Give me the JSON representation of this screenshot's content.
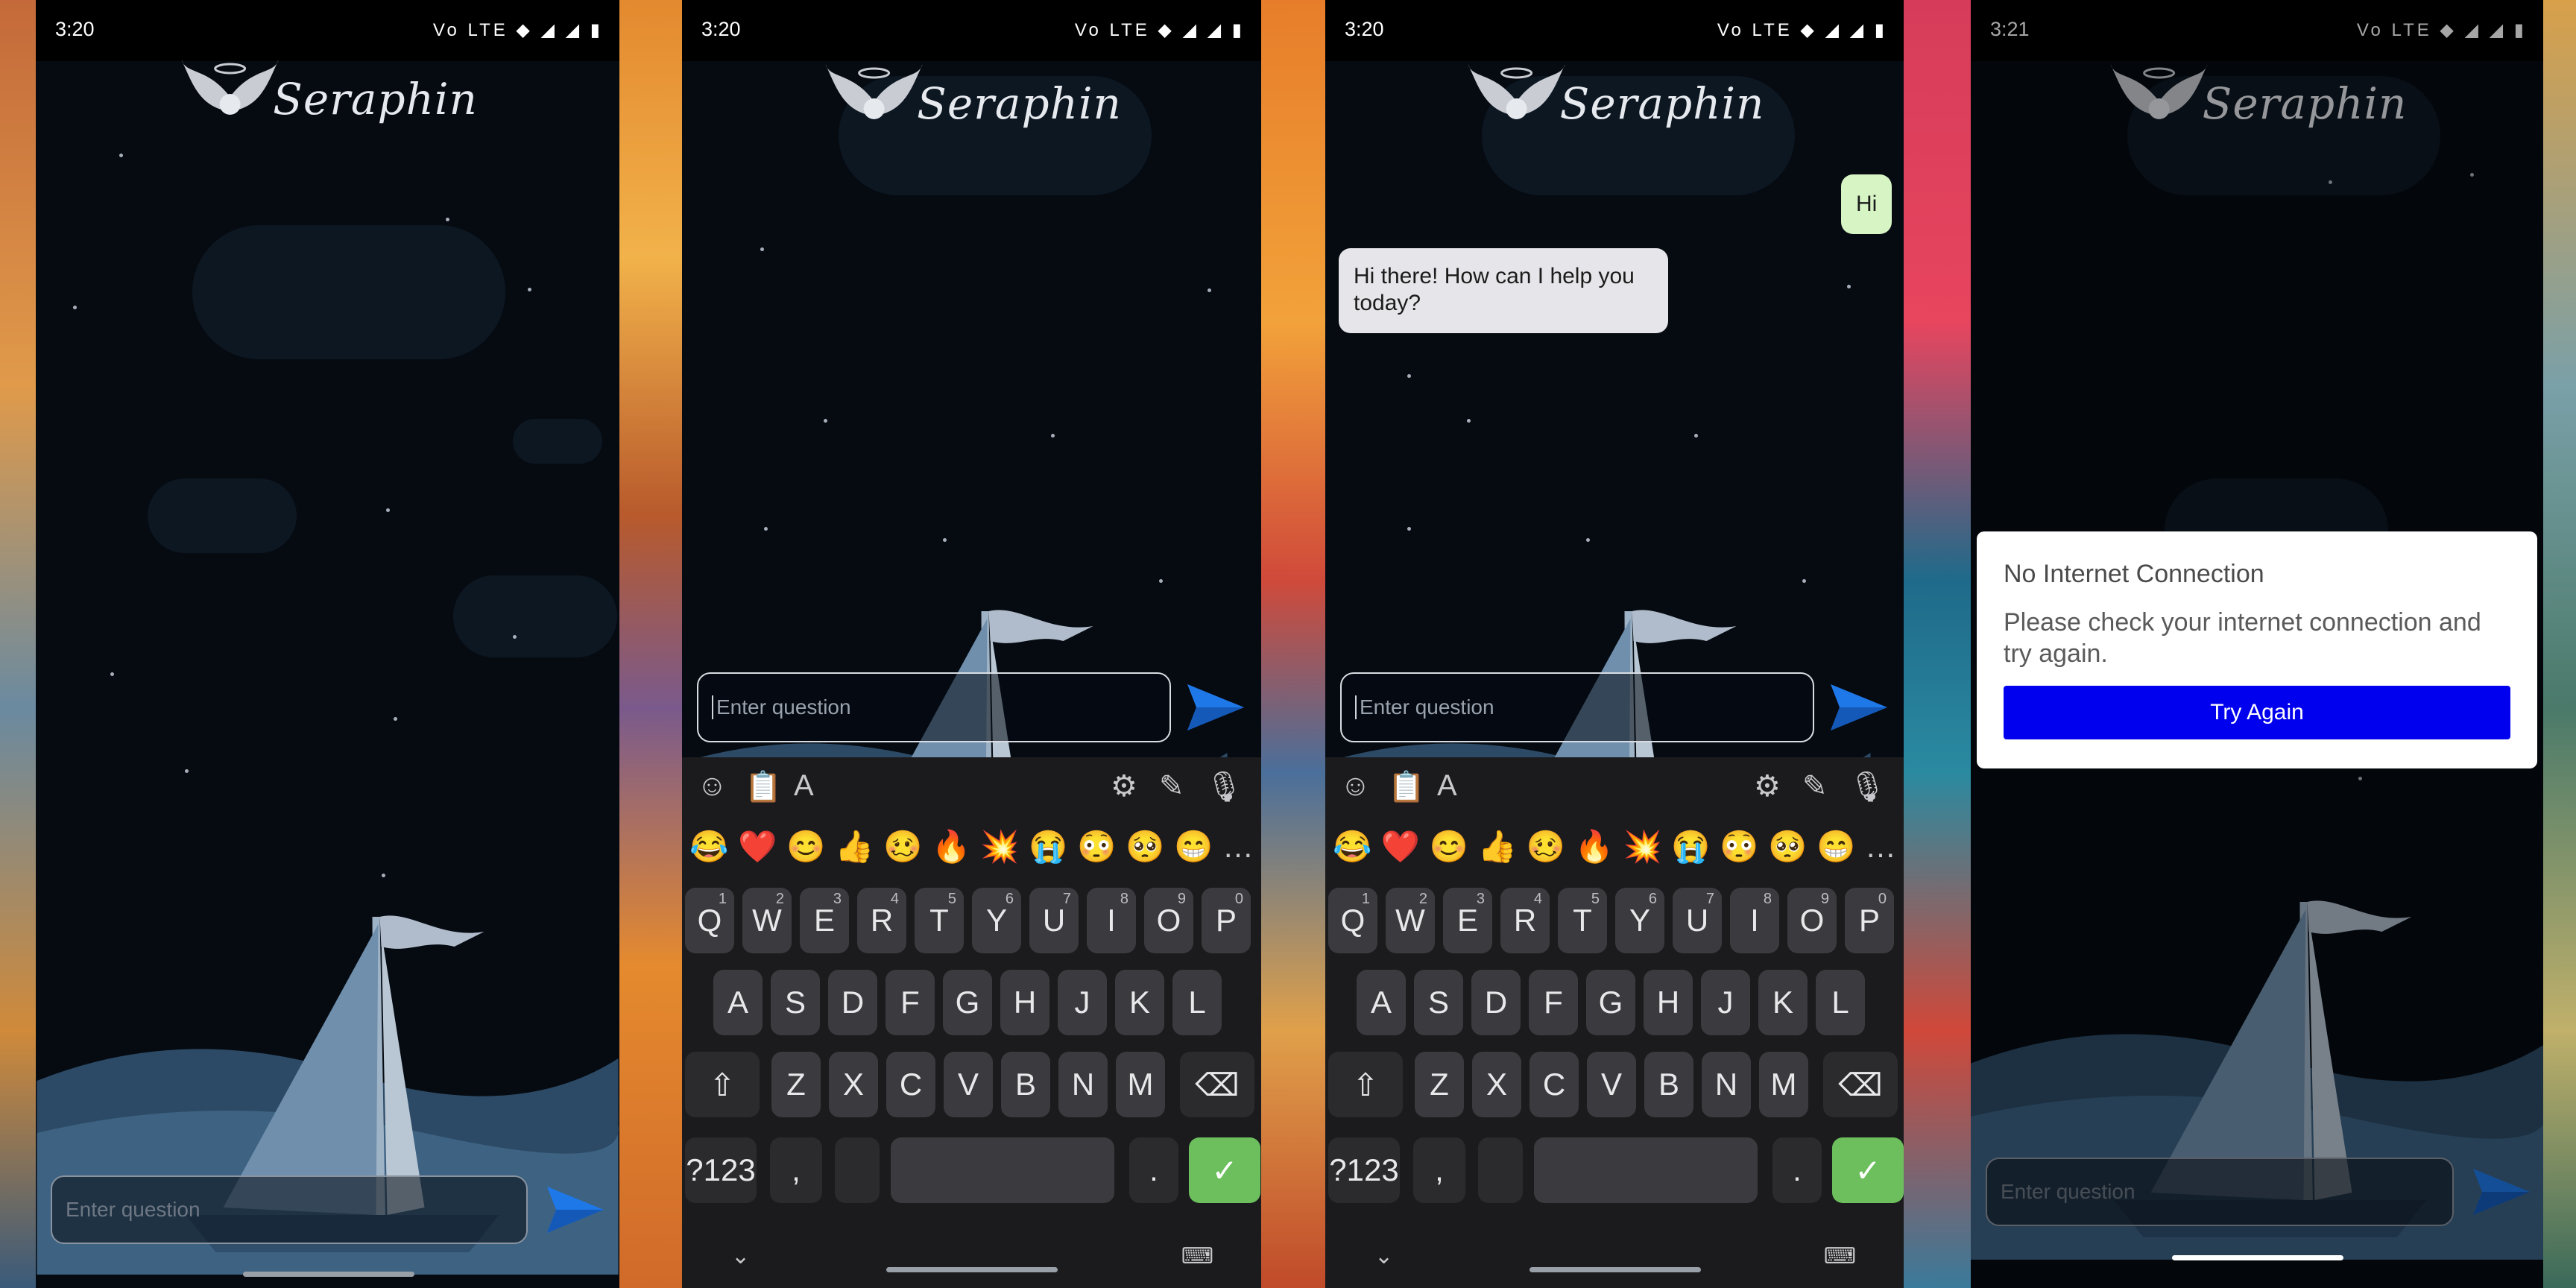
{
  "screens": [
    {
      "status": {
        "time": "3:20"
      },
      "logo": {
        "text": "Seraphin"
      },
      "input": {
        "placeholder": "Enter question"
      }
    },
    {
      "status": {
        "time": "3:20"
      },
      "logo": {
        "text": "Seraphin"
      },
      "input": {
        "placeholder": "Enter question"
      },
      "keyboard": true
    },
    {
      "status": {
        "time": "3:20"
      },
      "logo": {
        "text": "Seraphin"
      },
      "input": {
        "placeholder": "Enter question"
      },
      "messages": [
        {
          "role": "user",
          "text": "Hi"
        },
        {
          "role": "bot",
          "text": "Hi there! How can I help you today?"
        }
      ],
      "keyboard": true
    },
    {
      "status": {
        "time": "3:21"
      },
      "logo": {
        "text": "Seraphin"
      },
      "input": {
        "placeholder": "Enter question"
      },
      "dialog": {
        "title": "No Internet Connection",
        "message": "Please check your internet connection and try again.",
        "button": "Try Again"
      }
    }
  ],
  "status_icons": "Vo LTE ◆ ◢ ◢ ▮",
  "keyboard": {
    "emojis": [
      "😂",
      "❤️",
      "😊",
      "👍",
      "🥴",
      "🔥",
      "💥",
      "😭",
      "😳",
      "🥺",
      "😁",
      "…"
    ],
    "row1": [
      "Q",
      "W",
      "E",
      "R",
      "T",
      "Y",
      "U",
      "I",
      "O",
      "P"
    ],
    "row1_nums": [
      "1",
      "2",
      "3",
      "4",
      "5",
      "6",
      "7",
      "8",
      "9",
      "0"
    ],
    "row2": [
      "A",
      "S",
      "D",
      "F",
      "G",
      "H",
      "J",
      "K",
      "L"
    ],
    "row3": [
      "Z",
      "X",
      "C",
      "V",
      "B",
      "N",
      "M"
    ],
    "symbols_label": "?123",
    "comma": ",",
    "period": ".",
    "check": "✓",
    "shift": "⇧",
    "backspace": "⌫",
    "collapse": "⌄",
    "keyboard_switch": "⌨",
    "tools": {
      "sticker": "☺",
      "clipboard": "📋",
      "text": "A",
      "settings": "⚙",
      "pen": "✎",
      "mic": "🎙"
    }
  },
  "colors": {
    "user_bubble": "#d7f5c4",
    "bot_bubble": "#e6e6ea",
    "dialog_button": "#0000ee",
    "enter_key": "#6cbf5c",
    "send_arrow": "#1e78e8"
  }
}
